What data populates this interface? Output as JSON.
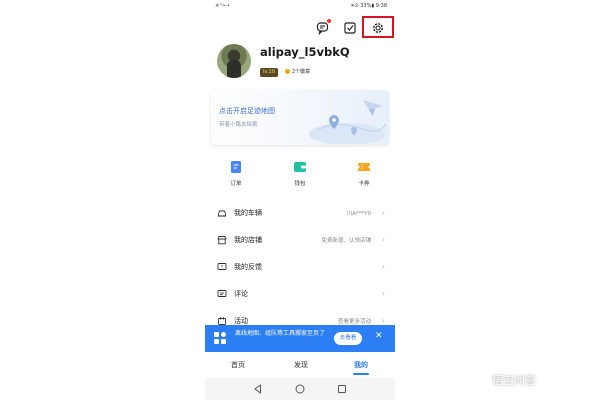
{
  "status_bar": {
    "left": "✳ᴬ✁•",
    "right": "✳⊙ 33%▮ 9:38"
  },
  "profile": {
    "username": "alipay_l5vbkQ",
    "level": "lv.10",
    "badges": "2个徽章"
  },
  "map_card": {
    "title": "点击开启足迹地图",
    "subtitle": "带着小路去探索"
  },
  "quick_actions": [
    {
      "label": "订单",
      "icon": "order-icon",
      "color": "#4a86f7"
    },
    {
      "label": "钱包",
      "icon": "wallet-icon",
      "color": "#1fc1a2"
    },
    {
      "label": "卡券",
      "icon": "coupon-icon",
      "color": "#f6a623"
    }
  ],
  "menu": [
    {
      "label": "我的车辆",
      "value": "川A***Y0",
      "icon": "car-icon"
    },
    {
      "label": "我的店铺",
      "value": "免费新增、认领店铺",
      "icon": "shop-icon"
    },
    {
      "label": "我的反馈",
      "value": "",
      "icon": "feedback-icon"
    },
    {
      "label": "评论",
      "value": "",
      "icon": "comment-icon"
    },
    {
      "label": "活动",
      "value": "查看更多活动",
      "icon": "activity-icon"
    }
  ],
  "banner": {
    "text": "离线地图、组队等工具搬家至页了",
    "button": "去看看",
    "close": "✕"
  },
  "tabs": [
    {
      "label": "首页",
      "active": false
    },
    {
      "label": "发现",
      "active": false
    },
    {
      "label": "我的",
      "active": true
    }
  ],
  "watermark": "悟空问答",
  "colors": {
    "accent": "#2c7ef5",
    "highlight_box": "#d6141e"
  }
}
